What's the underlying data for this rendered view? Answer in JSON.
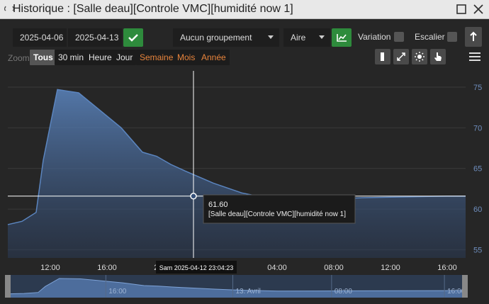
{
  "window": {
    "title": "Historique : [Salle deau][Controle VMC][humidité now 1]",
    "icons": [
      "history-icon",
      "maximize-icon",
      "close-icon"
    ]
  },
  "toolbar": {
    "date_start": "2025-04-06",
    "date_end": "2025-04-13",
    "grouping": "Aucun groupement",
    "chart_type": "Aire",
    "variation_label": "Variation",
    "escalier_label": "Escalier"
  },
  "zoom": {
    "label": "Zoom",
    "buttons": [
      "Tous",
      "30 min",
      "Heure",
      "Jour",
      "Semaine",
      "Mois",
      "Année"
    ],
    "active": "Tous",
    "tool_icons": [
      "column-icon",
      "compare-icon",
      "sun-icon",
      "pointer-icon"
    ]
  },
  "colors": {
    "accent_green": "#2e8b3c",
    "series_line": "#5b85bf",
    "series_fill": "#3f5f8f",
    "axis_label": "#6f8fbf",
    "zoom_orange": "#e8843c"
  },
  "tooltip": {
    "value": "61.60",
    "series": "[Salle deau][Controle VMC][humidité now 1]",
    "x_label": "Sam 2025-04-12 23:04:23"
  },
  "chart_data": {
    "type": "area",
    "series": [
      {
        "name": "[Salle deau][Controle VMC][humidité now 1]",
        "x": [
          0,
          1,
          2,
          2.5,
          3.5,
          5,
          8,
          9.5,
          10.5,
          11.5,
          12.5,
          14.5,
          16.5,
          19,
          22,
          25,
          28,
          31,
          32.3
        ],
        "values": [
          58.1,
          58.5,
          59.6,
          66,
          74.7,
          74.3,
          70,
          67,
          66.5,
          65.5,
          64.7,
          63.2,
          62,
          61.1,
          61.2,
          61.4,
          61.5,
          61.6,
          61.6
        ]
      }
    ],
    "x_axis": {
      "tick_labels": [
        "12:00",
        "16:00",
        "20:00",
        "04:00",
        "08:00",
        "12:00",
        "16:00"
      ],
      "tick_hours": [
        3,
        7,
        11,
        19,
        23,
        27,
        31
      ],
      "range": [
        0,
        32.3
      ]
    },
    "y_axis": {
      "tick_labels": [
        "55",
        "60",
        "65",
        "70",
        "75"
      ],
      "range": [
        54,
        77
      ]
    },
    "crosshair_x": 13.1,
    "navigator_labels": [
      "16:00",
      "13. Avril",
      "08:00",
      "16:00"
    ],
    "navigator_tick_hours": [
      7,
      16,
      23,
      31
    ]
  }
}
